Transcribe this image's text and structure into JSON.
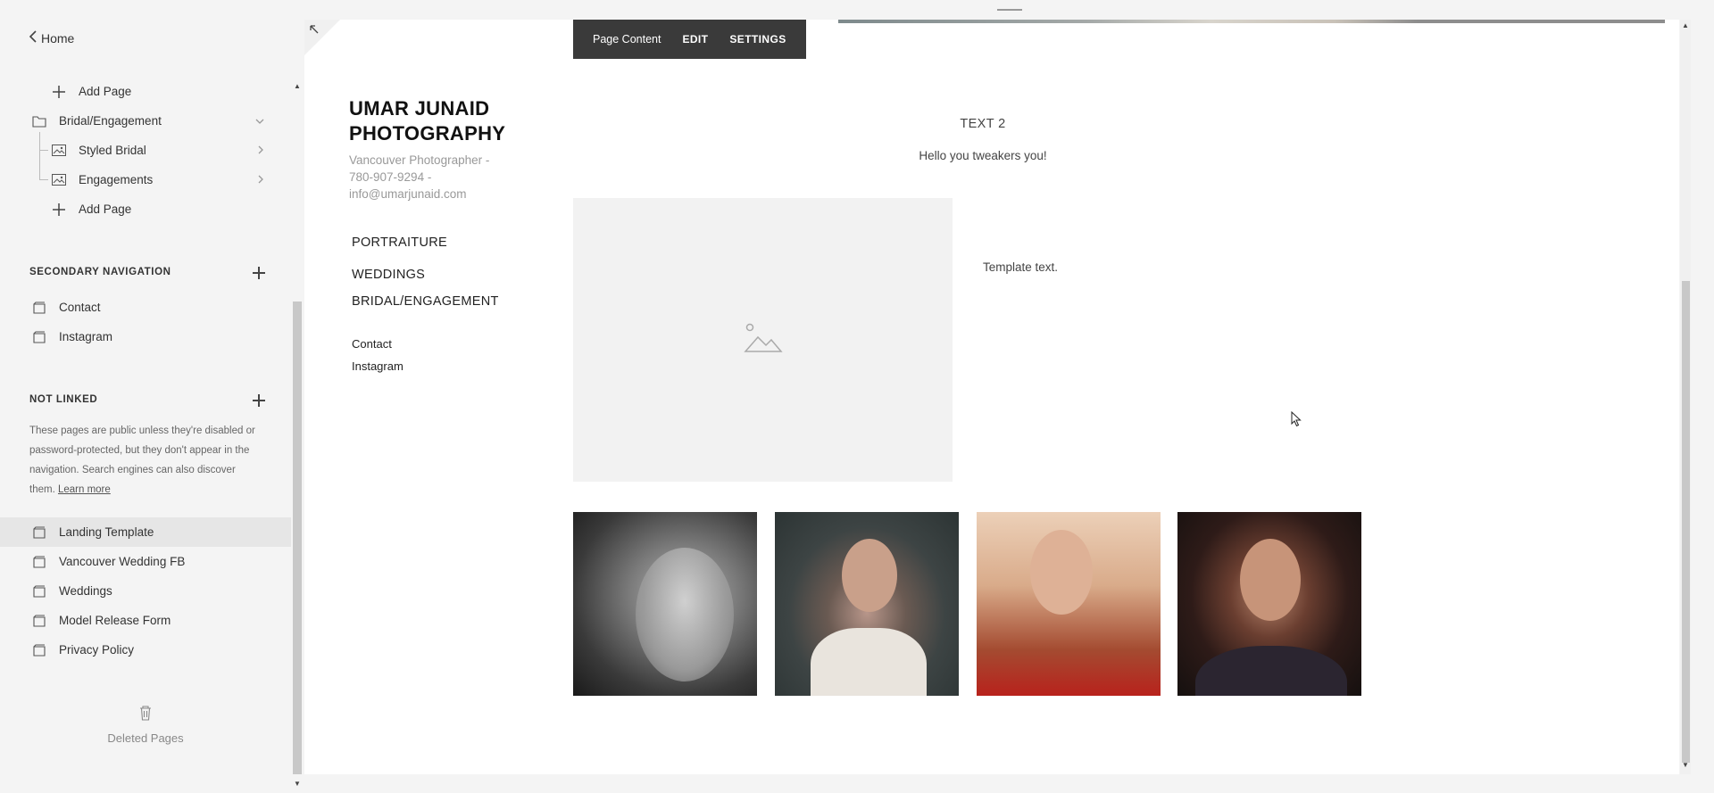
{
  "sidebar": {
    "home_label": "Home",
    "main_items": [
      {
        "label": "Add Page",
        "icon": "plus-icon"
      },
      {
        "label": "Bridal/Engagement",
        "icon": "folder-icon"
      },
      {
        "label": "Styled Bridal",
        "icon": "gallery-icon"
      },
      {
        "label": "Engagements",
        "icon": "gallery-icon"
      },
      {
        "label": "Add Page",
        "icon": "plus-icon"
      }
    ],
    "secondary": {
      "title": "SECONDARY NAVIGATION",
      "items": [
        {
          "label": "Contact",
          "icon": "page-icon"
        },
        {
          "label": "Instagram",
          "icon": "page-icon"
        }
      ]
    },
    "not_linked": {
      "title": "NOT LINKED",
      "note": "These pages are public unless they're disabled or password-protected, but they don't appear in the navigation. Search engines can also discover them.",
      "learn_more": "Learn more",
      "items": [
        {
          "label": "Landing Template",
          "icon": "page-icon",
          "selected": true
        },
        {
          "label": "Vancouver Wedding FB",
          "icon": "page-icon"
        },
        {
          "label": "Weddings",
          "icon": "page-icon"
        },
        {
          "label": "Model Release Form",
          "icon": "page-icon"
        },
        {
          "label": "Privacy Policy",
          "icon": "page-icon"
        }
      ]
    },
    "deleted_label": "Deleted Pages"
  },
  "toolbar": {
    "page_content": "Page Content",
    "edit": "EDIT",
    "settings": "SETTINGS"
  },
  "site": {
    "title_line1": "UMAR JUNAID",
    "title_line2": "PHOTOGRAPHY",
    "desc_line1": "Vancouver Photographer -",
    "desc_line2": "780-907-9294 -",
    "desc_line3": "info@umarjunaid.com",
    "nav": [
      "PORTRAITURE",
      "WEDDINGS",
      "BRIDAL/ENGAGEMENT"
    ],
    "nav_secondary": [
      "Contact",
      "Instagram"
    ]
  },
  "content": {
    "block_title": "TEXT 2",
    "block_text": "Hello you tweakers you!",
    "template_text": "Template text."
  },
  "colors": {
    "toolbar_bg": "#3a3a3a",
    "selected_row_bg": "#e6e6e6",
    "sidebar_bg": "#f4f4f4"
  }
}
